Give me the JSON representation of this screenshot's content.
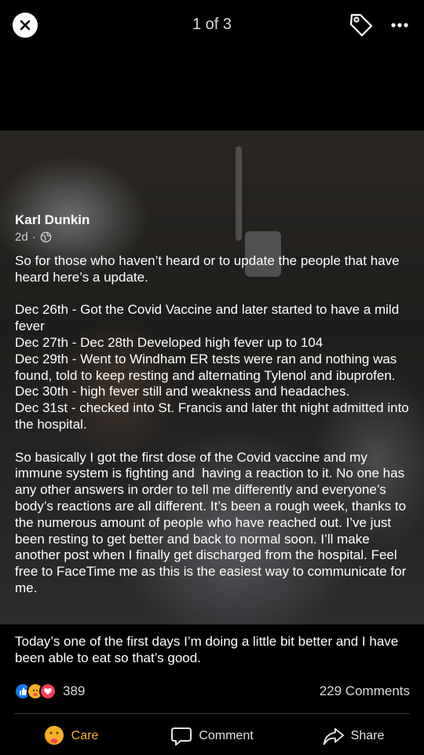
{
  "header": {
    "counter": "1 of 3",
    "close_icon": "close-icon",
    "tag_icon": "tag-icon",
    "more_icon": "more-icon"
  },
  "post": {
    "author": "Karl Dunkin",
    "time": "2d",
    "separator": "·",
    "privacy_icon": "globe-icon",
    "body": "So for those who haven’t heard or to update the people that have heard here’s a update.\n\nDec 26th - Got the Covid Vaccine and later started to have a mild fever\nDec 27th - Dec 28th Developed high fever up to 104\nDec 29th - Went to Windham ER tests were ran and nothing was found, told to keep resting and alternating Tylenol and ibuprofen.\nDec 30th - high fever still and weakness and headaches.\nDec 31st - checked into St. Francis and later tht night admitted into the hospital.\n\nSo basically I got the first dose of the Covid vaccine and my immune system is fighting and  having a reaction to it. No one has any other answers in order to tell me differently and everyone’s body’s reactions are all different. It’s been a rough week, thanks to the numerous amount of people who have reached out. I’ve just been resting to get better and back to normal soon. I’ll make another post when I finally get discharged from the hospital. Feel free to FaceTime me as this is the easiest way to communicate for me."
  },
  "caption": "Today’s one of the first days I’m doing a little bit better and I have been able to eat so that’s good.",
  "stats": {
    "reaction_count": "389",
    "comments_label": "229 Comments"
  },
  "actions": {
    "care_label": "Care",
    "comment_label": "Comment",
    "share_label": "Share"
  },
  "colors": {
    "care": "#f7b125",
    "like": "#1877f2",
    "love": "#f33e58"
  }
}
